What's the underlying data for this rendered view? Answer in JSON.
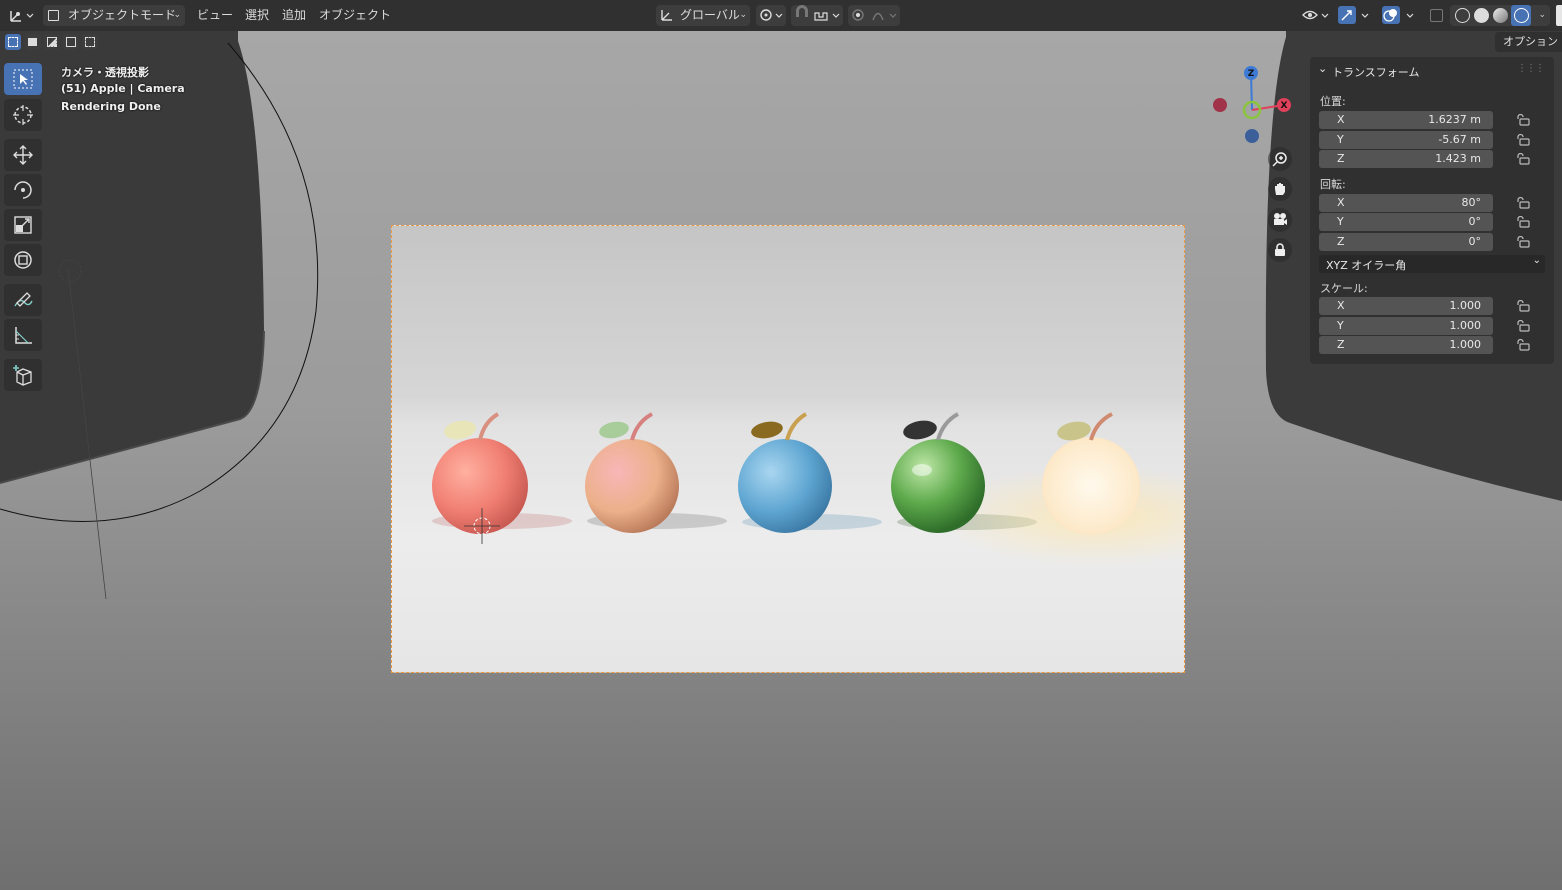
{
  "header": {
    "mode_label": "オブジェクトモード",
    "menus": [
      "ビュー",
      "選択",
      "追加",
      "オブジェクト"
    ],
    "transform_orientation": "グローバル"
  },
  "viewport": {
    "info_line1": "カメラ・透視投影",
    "info_line2": "(51) Apple | Camera",
    "info_line3": "Rendering Done"
  },
  "panel": {
    "options_label": "オプション",
    "title": "トランスフォーム",
    "location_label": "位置:",
    "location": [
      {
        "axis": "X",
        "value": "1.6237 m"
      },
      {
        "axis": "Y",
        "value": "-5.67 m"
      },
      {
        "axis": "Z",
        "value": "1.423 m"
      }
    ],
    "rotation_label": "回転:",
    "rotation": [
      {
        "axis": "X",
        "value": "80°"
      },
      {
        "axis": "Y",
        "value": "0°"
      },
      {
        "axis": "Z",
        "value": "0°"
      }
    ],
    "rotation_mode": "XYZ オイラー角",
    "scale_label": "スケール:",
    "scale": [
      {
        "axis": "X",
        "value": "1.000"
      },
      {
        "axis": "Y",
        "value": "1.000"
      },
      {
        "axis": "Z",
        "value": "1.000"
      }
    ]
  },
  "gizmo": {
    "z": "Z",
    "x": "X"
  },
  "colors": {
    "accent": "#4772b3",
    "camera_frame": "#e89a44",
    "x_axis": "#e0405a",
    "y_axis": "#8ac43c",
    "z_axis": "#3c7ad6"
  }
}
